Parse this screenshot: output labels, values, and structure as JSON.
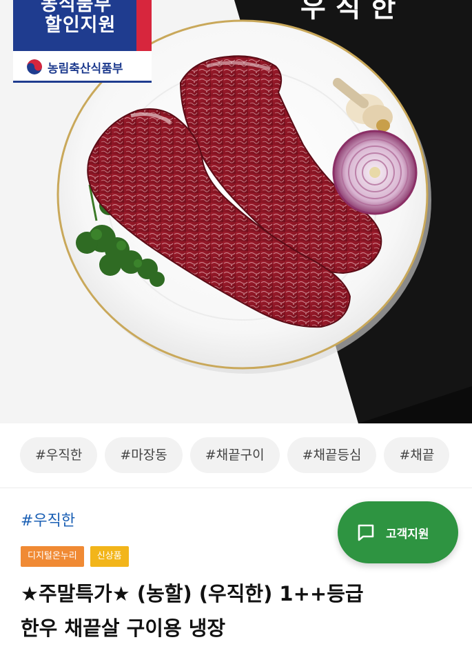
{
  "promo_badge": {
    "line1": "농식품부",
    "line2": "할인지원",
    "ministry": "농림축산식품부"
  },
  "brand_logo": "우직한",
  "hashtags": [
    "#우직한",
    "#마장동",
    "#채끝구이",
    "#채끝등심",
    "#채끝"
  ],
  "product": {
    "shop_tag": "#우직한",
    "badges": [
      "디지털온누리",
      "신상품"
    ],
    "title_line1": "★주말특가★ (농할) (우직한) 1++등급",
    "title_line2": "한우 채끝살 구이용 냉장"
  },
  "support_button": {
    "label": "고객지원",
    "icon": "chat-bubble-icon"
  },
  "colors": {
    "badge_blue": "#1f3c8f",
    "badge_red": "#d7263d",
    "shop_tag_blue": "#1a5fb4",
    "pill_digital": "#f08a34",
    "pill_new": "#f2b51a",
    "support_green": "#2e9441"
  }
}
